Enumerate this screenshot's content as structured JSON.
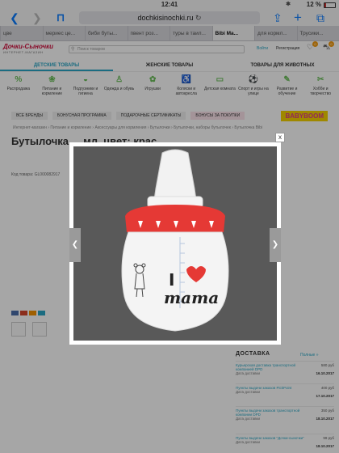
{
  "status": {
    "time": "12:41",
    "battery": "12 %"
  },
  "browser": {
    "url": "dochkisinochki.ru"
  },
  "tabs": [
    "цве",
    "мериес це...",
    "биби буты...",
    "пвент роз...",
    "туры в таил...",
    "Bibi Ma...",
    "для кормл...",
    "Трусики..."
  ],
  "header": {
    "logo_main": "Дочки-Сыночки",
    "logo_sub": "ИНТЕРНЕТ-МАГАЗИН",
    "phone": "8 495 360-72-07",
    "search_placeholder": "Поиск товаров",
    "login": "Войти",
    "register": "Регистрация",
    "badge1": "0",
    "badge2": "0"
  },
  "categories": [
    "ДЕТСКИЕ ТОВАРЫ",
    "ЖЕНСКИЕ ТОВАРЫ",
    "ТОВАРЫ ДЛЯ ЖИВОТНЫХ"
  ],
  "subcategories": [
    {
      "label": "Распродажа",
      "icon": "sale-icon"
    },
    {
      "label": "Питание и кормление",
      "icon": "food-icon"
    },
    {
      "label": "Подгузники и гигиена",
      "icon": "diaper-icon"
    },
    {
      "label": "Одежда и обувь",
      "icon": "clothes-icon"
    },
    {
      "label": "Игрушки",
      "icon": "toys-icon"
    },
    {
      "label": "Коляски и автокресла",
      "icon": "stroller-icon"
    },
    {
      "label": "Детская комната",
      "icon": "bed-icon"
    },
    {
      "label": "Спорт и игры на улице",
      "icon": "sport-icon"
    },
    {
      "label": "Развитие и обучение",
      "icon": "education-icon"
    },
    {
      "label": "Хобби и творчество",
      "icon": "hobby-icon"
    }
  ],
  "bar": {
    "brands": "ВСЕ БРЕНДЫ",
    "bonus": "БОНУСНАЯ ПРОГРАММА",
    "certs": "ПОДАРОЧНЫЕ СЕРТИФИКАТЫ",
    "bonus_buy": "БОНУСЫ ЗА ПОКУПКИ",
    "babyboom": "BABYBOOM"
  },
  "breadcrumbs": "Интернет-магазин › Питание и кормление › Аксессуары для кормления › Бутылочки › Бутылочки, наборы бутылочек › Бутылочка Bibi",
  "product": {
    "title": "Бутылочка ... мл, цвет: крас...",
    "code": "Код товара: GL000082917"
  },
  "delivery": {
    "title": "ДОСТАВКА",
    "all_link": "Полные »",
    "rows": [
      {
        "name": "Курьерская доставка транспортной компанией DPD",
        "price": "580 руб",
        "date_label": "Дата доставки",
        "date": "16.10.2017"
      },
      {
        "name": "Пункты выдачи заказов PickPoint",
        "price": "400 руб",
        "date_label": "Дата доставки",
        "date": "17.10.2017"
      },
      {
        "name": "Пункты выдачи заказов транспортной компании DPD",
        "price": "350 руб",
        "date_label": "Дата доставки",
        "date": "18.10.2017"
      },
      {
        "name": "Пункты выдачи заказов \"Дочки-сыночки\"",
        "price": "99 руб",
        "date_label": "Дата доставки",
        "date": "18.10.2017"
      }
    ]
  },
  "bottle": {
    "text_i": "I",
    "text_mama": "mama"
  },
  "modal": {
    "close": "x",
    "prev": "❮",
    "next": "❯"
  }
}
